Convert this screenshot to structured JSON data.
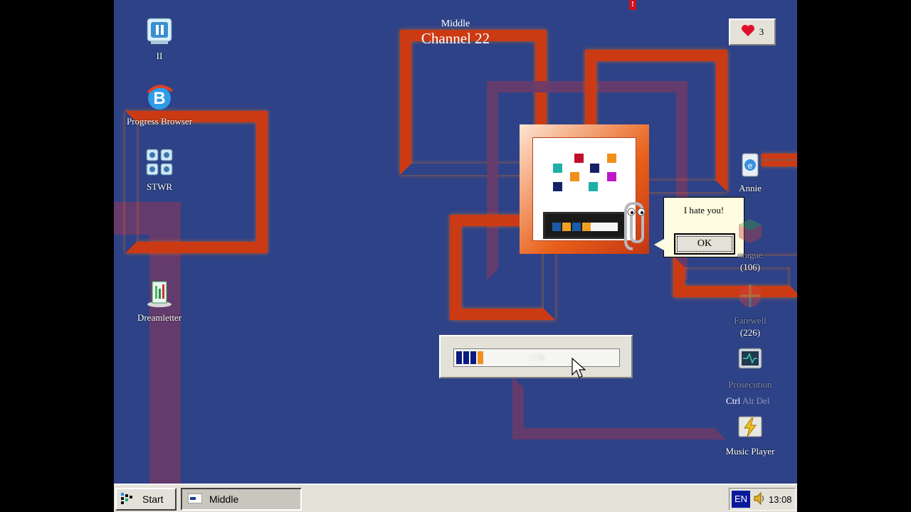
{
  "desktop": {
    "icons_left": [
      {
        "label": "II",
        "icon": "pause-monitor-icon"
      },
      {
        "label": "Progress Browser",
        "icon": "browser-icon"
      },
      {
        "label": "STWR",
        "icon": "grid-icon"
      },
      {
        "label": "Dreamletter",
        "icon": "document-icon"
      }
    ],
    "icons_right": [
      {
        "label": "Annie",
        "icon": "recycle-bin-icon"
      },
      {
        "label": "orague",
        "count": "(106)",
        "icon": "cube-icon"
      },
      {
        "label": "Farewell",
        "count": "(226)",
        "icon": "globe-icon"
      },
      {
        "label": "Prosecution",
        "icon": "monitor-icon"
      },
      {
        "label": "Music Player",
        "icon": "lightning-icon"
      }
    ]
  },
  "channel": {
    "subtitle": "Middle",
    "title": "Channel 22"
  },
  "lives": {
    "count": "3",
    "icon": "heart-icon"
  },
  "alert": {
    "mark": "!"
  },
  "dialog": {
    "message": "I hate you!",
    "ok_label": "OK"
  },
  "progress": {
    "percent_label": "15%",
    "value": 0.15
  },
  "ctrl_alt_del": {
    "ctrl": "Ctrl",
    "alt": "Alt",
    "del": "Del"
  },
  "taskbar": {
    "start_label": "Start",
    "task_label": "Middle",
    "lang": "EN",
    "clock": "13:08"
  },
  "colors": {
    "desktop": "#2e4287",
    "pipe": "#cc3a14",
    "pipe_faded": "#6a3b6b",
    "dialog_bg": "#fffde1"
  }
}
